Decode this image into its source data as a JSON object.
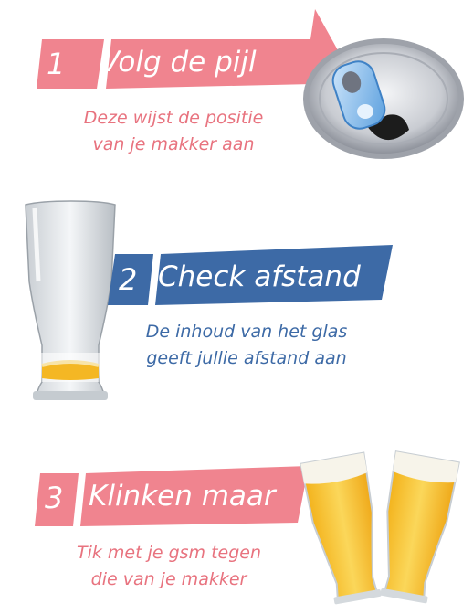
{
  "steps": [
    {
      "number": "1",
      "title": "Volg de pijl",
      "description_line1": "Deze wijst de positie",
      "description_line2": "van je makker aan",
      "color": "#f0848f",
      "text_color": "#e8737f",
      "illustration": "soda-can-top-icon"
    },
    {
      "number": "2",
      "title": "Check afstand",
      "description_line1": "De inhoud van het glas",
      "description_line2": "geeft jullie afstand aan",
      "color": "#3d6aa6",
      "text_color": "#3d6aa6",
      "illustration": "beer-glass-empty-icon"
    },
    {
      "number": "3",
      "title": "Klinken maar",
      "description_line1": "Tik met je gsm tegen",
      "description_line2": "die van je makker",
      "color": "#f0848f",
      "text_color": "#e8737f",
      "illustration": "beer-glasses-cheers-icon"
    }
  ]
}
